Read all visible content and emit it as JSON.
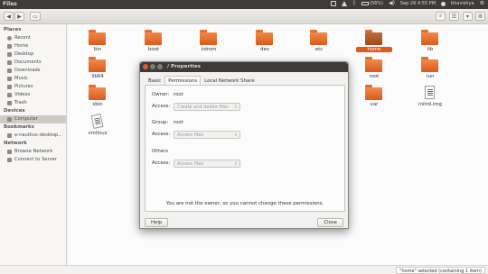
{
  "top_panel": {
    "app_title": "Files",
    "battery": "(56%)",
    "datetime": "Sep 26 4:55 PM",
    "user": "bhavishya"
  },
  "sidebar": {
    "places_header": "Places",
    "places": [
      "Recent",
      "Home",
      "Desktop",
      "Documents",
      "Downloads",
      "Music",
      "Pictures",
      "Videos",
      "Trash"
    ],
    "devices_header": "Devices",
    "devices": [
      "Computer"
    ],
    "bookmarks_header": "Bookmarks",
    "bookmarks": [
      "e-nautilus-desktop..."
    ],
    "network_header": "Network",
    "network": [
      "Browse Network",
      "Connect to Server"
    ]
  },
  "files": [
    "bin",
    "boot",
    "cdrom",
    "dev",
    "etc",
    "home",
    "lib",
    "lib64",
    "root",
    "run",
    "sbin",
    "var",
    "initrd.img",
    "vmlinuz"
  ],
  "status": "\"home\" selected  (containing 1 item)",
  "dialog": {
    "title": "/ Properties",
    "tabs": [
      "Basic",
      "Permissions",
      "Local Network Share"
    ],
    "owner_label": "Owner:",
    "owner_value": "root",
    "access_label": "Access:",
    "owner_access": "Create and delete files",
    "group_label": "Group:",
    "group_value": "root",
    "group_access": "Access files",
    "others_label": "Others",
    "others_access": "Access files",
    "note": "You are not the owner, so you cannot change these permissions.",
    "help_button": "Help",
    "close_button": "Close"
  }
}
